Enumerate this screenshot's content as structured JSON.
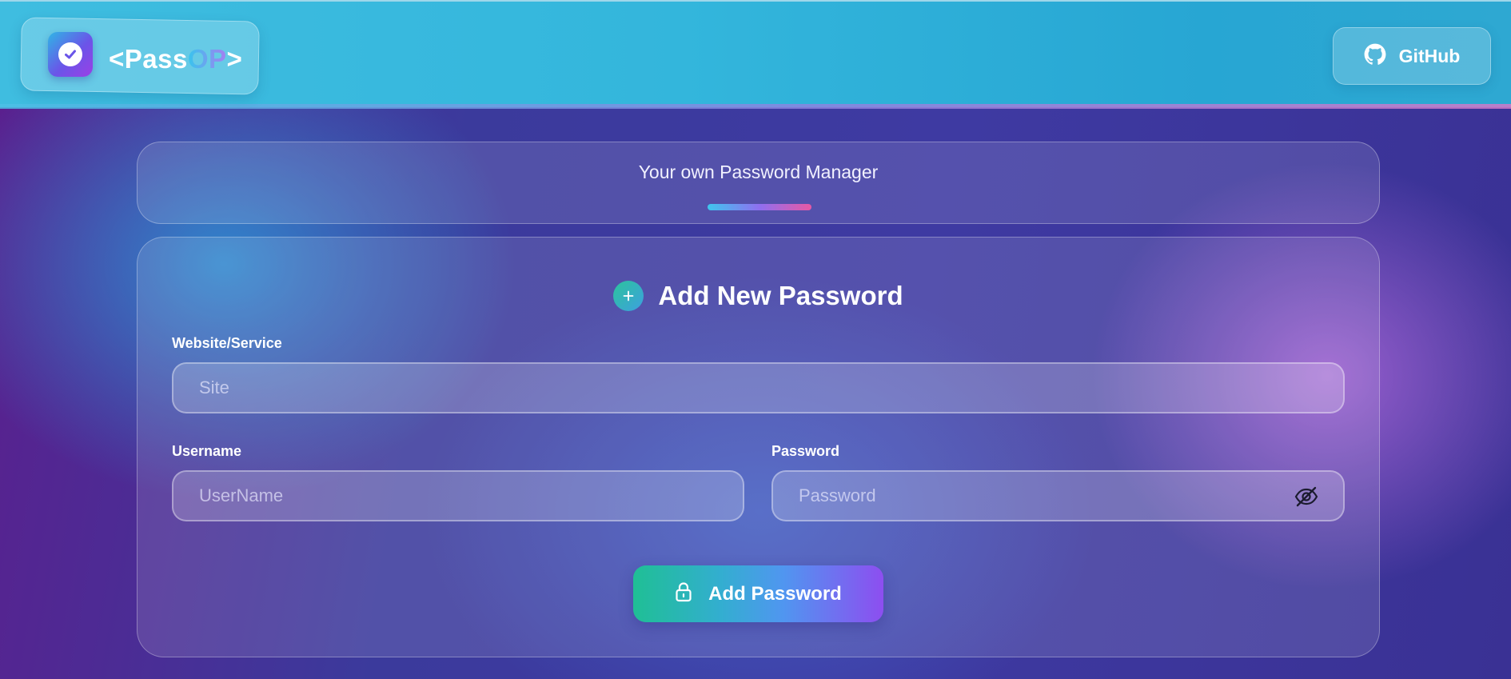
{
  "header": {
    "logo": {
      "prefix": "<",
      "word": "Pass",
      "accent": "OP",
      "suffix": ">",
      "icon": "check-circle-icon"
    },
    "github_button": {
      "label": "GitHub",
      "icon": "github-icon"
    }
  },
  "tagline": {
    "text": "Your own Password Manager"
  },
  "form": {
    "title": "Add New Password",
    "title_icon": "plus-icon",
    "website": {
      "label": "Website/Service",
      "placeholder": "Site",
      "value": ""
    },
    "username": {
      "label": "Username",
      "placeholder": "UserName",
      "value": ""
    },
    "password": {
      "label": "Password",
      "placeholder": "Password",
      "value": "",
      "toggle_icon": "eye-off-icon"
    },
    "submit": {
      "label": "Add Password",
      "icon": "lock-icon"
    }
  },
  "colors": {
    "header_bg": "#33b6dc",
    "page_bg": "#3e3aa2",
    "accent_gradient_start": "#1fbf95",
    "accent_gradient_end": "#8d4ef0",
    "tagline_bar_end": "#e659a4"
  }
}
